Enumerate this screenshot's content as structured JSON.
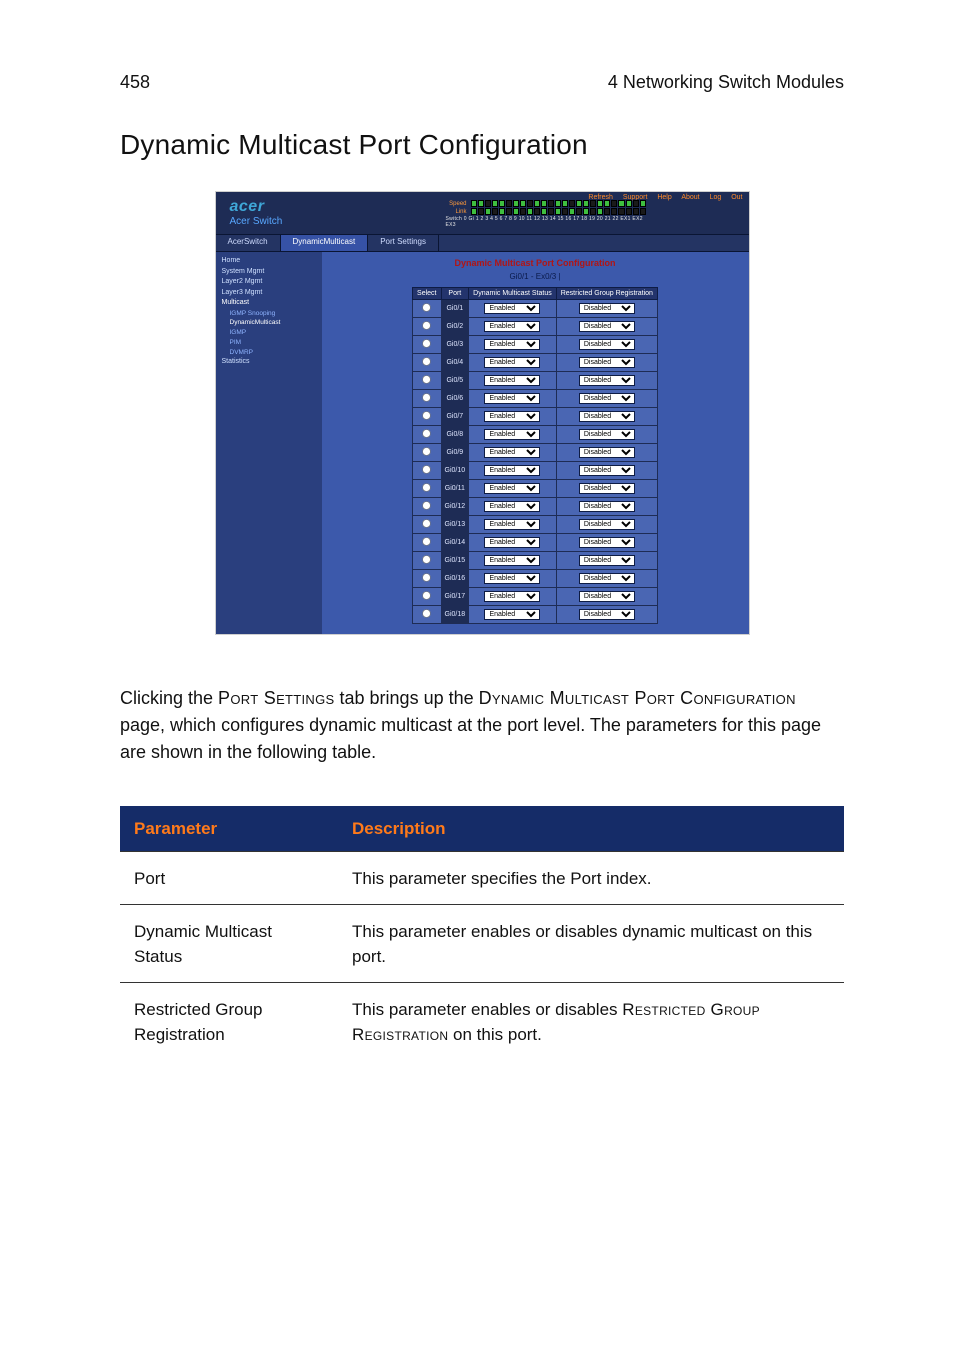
{
  "running_head": {
    "page_no": "458",
    "chapter": "4 Networking Switch Modules"
  },
  "heading": "Dynamic Multicast Port Configuration",
  "body_paragraph": {
    "pre1": "Clicking the ",
    "sc1": "Port Settings",
    "mid1": " tab brings up the ",
    "sc2": "Dynamic Multicast Port Configuration",
    "mid2": " page, which configures dynamic multicast at the port level. The parameters for this page are shown in the following table."
  },
  "param_table": {
    "head": {
      "c1": "Parameter",
      "c2": "Description"
    },
    "rows": [
      {
        "param": "Port",
        "desc_plain": "This parameter specifies the Port index."
      },
      {
        "param": "Dynamic Multicast Status",
        "desc_plain": "This parameter enables or disables dynamic multicast on this port."
      },
      {
        "param": "Restricted Group Registration",
        "desc_pre": "This parameter enables or disables ",
        "desc_sc1": "Restricted Group Registration",
        "desc_post": " on this port."
      }
    ]
  },
  "screenshot": {
    "brand": {
      "name": "acer",
      "sub": "Acer Switch"
    },
    "topnav": [
      "Refresh",
      "Support",
      "Help",
      "About",
      "Log Out"
    ],
    "port_strip": {
      "rows": [
        "Speed",
        "Link"
      ],
      "numbers": "Switch 0 Gi 1 2 3 4 5 6 7 8 9 10 11 12 13 14 15 16 17 18 19 20 21 22 EX1 EX2 EX3"
    },
    "crumbs": [
      "AcerSwitch",
      "DynamicMulticast",
      "Port Settings"
    ],
    "sidebar": [
      {
        "label": "Home",
        "cls": "l0"
      },
      {
        "label": "System Mgmt",
        "cls": "l0"
      },
      {
        "label": "Layer2 Mgmt",
        "cls": "l0"
      },
      {
        "label": "Layer3 Mgmt",
        "cls": "l0"
      },
      {
        "label": "Multicast",
        "cls": "l0 sel"
      },
      {
        "label": "IGMP Snooping",
        "cls": "l1"
      },
      {
        "label": "DynamicMulticast",
        "cls": "l1 sel"
      },
      {
        "label": "IGMP",
        "cls": "l1"
      },
      {
        "label": "PIM",
        "cls": "l1"
      },
      {
        "label": "DVMRP",
        "cls": "l1"
      },
      {
        "label": "Statistics",
        "cls": "l0"
      }
    ],
    "main_title": "Dynamic Multicast Port Configuration",
    "main_sub": "Gi0/1 - Ex0/3 |",
    "columns": [
      "Select",
      "Port",
      "Dynamic Multicast Status",
      "Restricted Group Registration"
    ],
    "status_value": "Enabled",
    "reg_value": "Disabled",
    "ports": [
      "Gi0/1",
      "Gi0/2",
      "Gi0/3",
      "Gi0/4",
      "Gi0/5",
      "Gi0/6",
      "Gi0/7",
      "Gi0/8",
      "Gi0/9",
      "Gi0/10",
      "Gi0/11",
      "Gi0/12",
      "Gi0/13",
      "Gi0/14",
      "Gi0/15",
      "Gi0/16",
      "Gi0/17",
      "Gi0/18"
    ]
  }
}
